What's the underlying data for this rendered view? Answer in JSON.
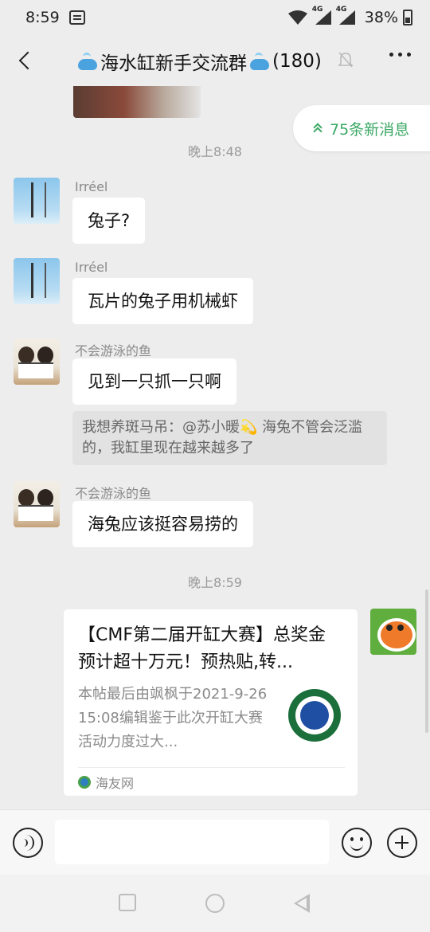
{
  "status_bar": {
    "time": "8:59",
    "network_1": "4G",
    "network_2": "4G",
    "battery_percent": "38%"
  },
  "header": {
    "title_prefix": "海水缸新手交流群",
    "member_count": "(180)",
    "muted": true
  },
  "new_messages_pill": "75条新消息",
  "timestamps": [
    "晚上8:48",
    "晚上8:59"
  ],
  "messages": [
    {
      "sender": "Irréel",
      "text": "兔子?"
    },
    {
      "sender": "Irréel",
      "text": "瓦片的兔子用机械虾"
    },
    {
      "sender": "不会游泳的鱼",
      "text": "见到一只抓一只啊",
      "quote": "我想养斑马吊：@苏小暖💫 海兔不管会泛滥的，我缸里现在越来越多了"
    },
    {
      "sender": "不会游泳的鱼",
      "text": "海兔应该挺容易捞的"
    }
  ],
  "link_card": {
    "title": "【CMF第二届开缸大赛】总奖金预计超十万元！预热贴,转...",
    "description": "本帖最后由飒枫于2021-9-2615:08编辑鉴于此次开缸大赛活动力度过大...",
    "source": "海友网"
  },
  "input": {
    "value": "",
    "placeholder": ""
  },
  "icons": {
    "back": "chevron-left-icon",
    "mute": "bell-off-icon",
    "more": "more-dots-icon",
    "voice": "voice-icon",
    "emoji": "emoji-icon",
    "plus": "plus-icon"
  },
  "colors": {
    "accent_green": "#3aa864",
    "chat_background": "#ededed",
    "bubble": "#ffffff"
  }
}
